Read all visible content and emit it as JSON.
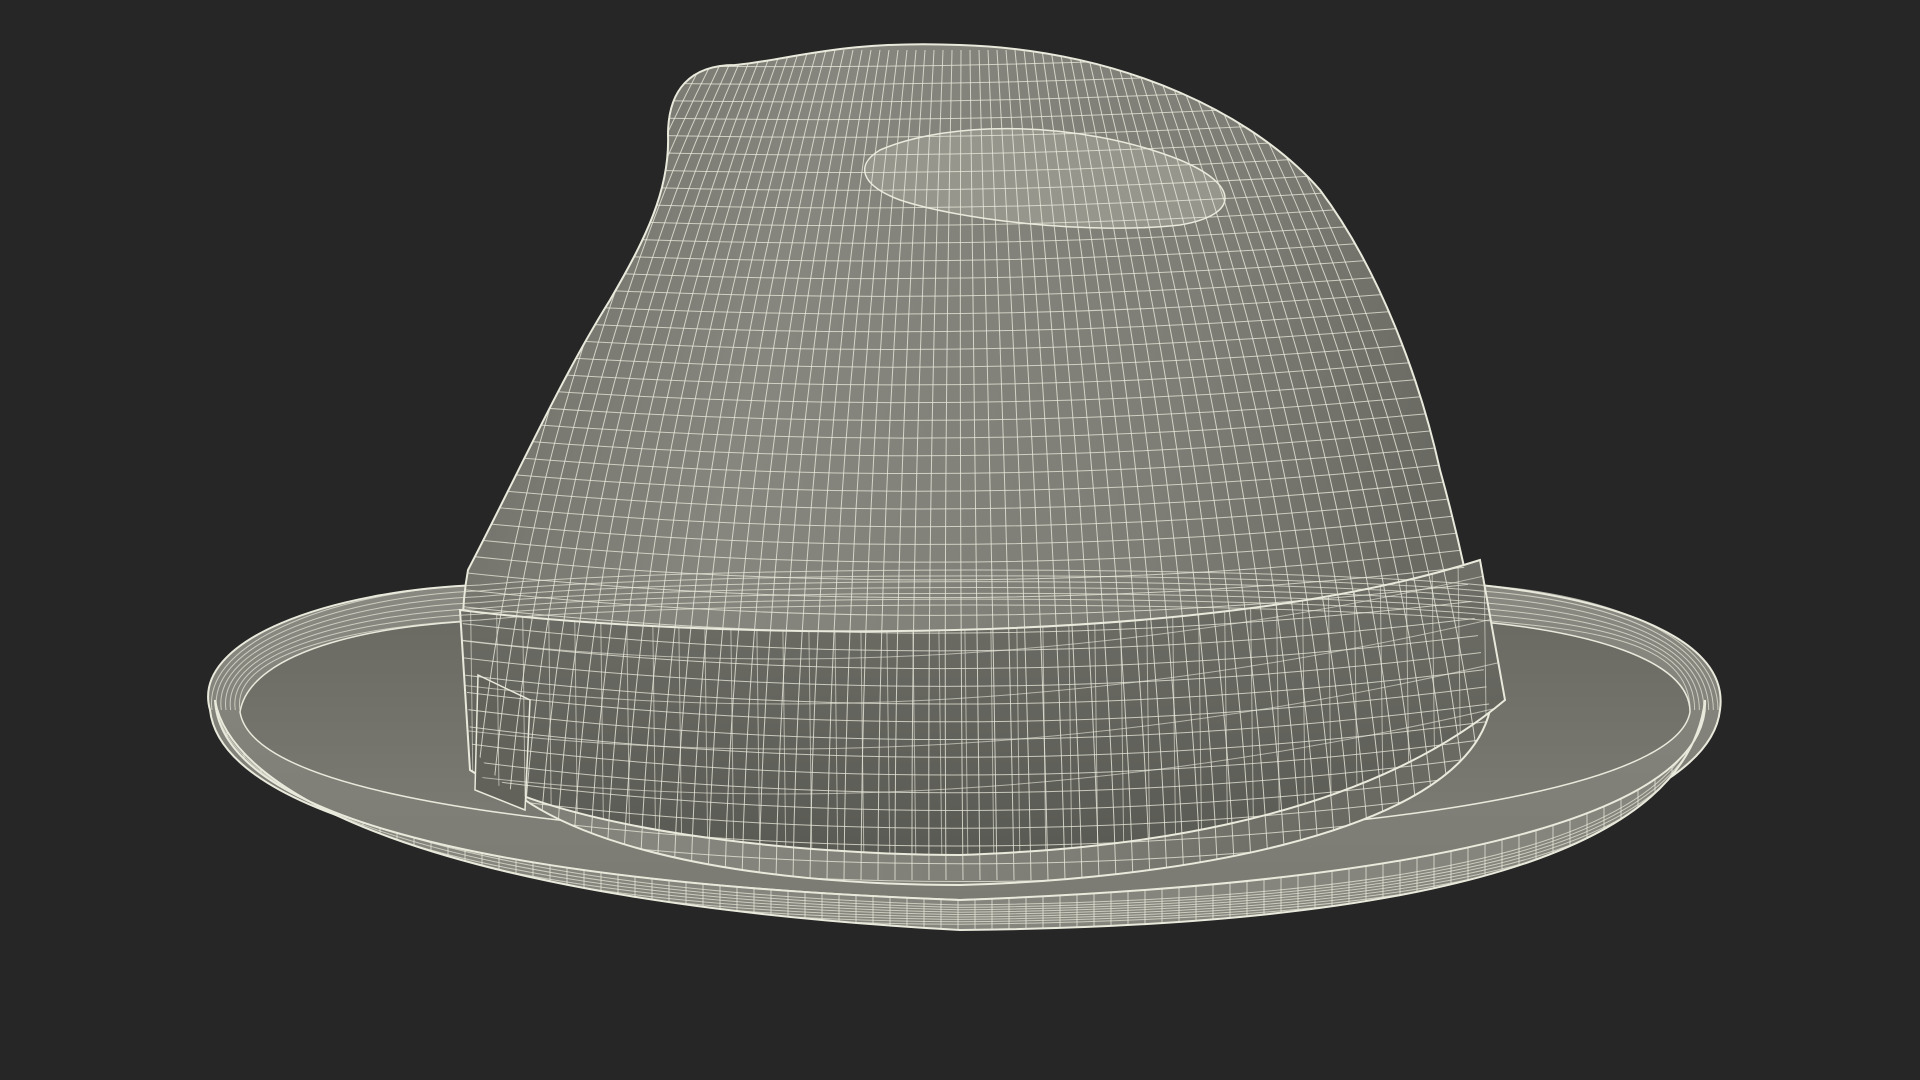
{
  "scene": {
    "background_color": "#262626",
    "subject": "hat-wireframe",
    "shading": {
      "surface_light": "#8e8e86",
      "surface_mid": "#7a7a72",
      "surface_dark": "#5d5d56",
      "wire_color": "#e9e9dc"
    }
  }
}
